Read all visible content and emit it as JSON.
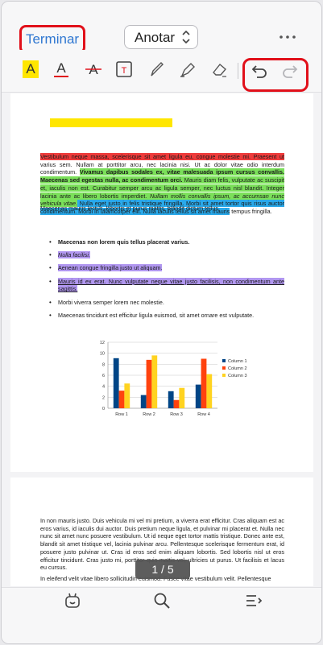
{
  "header": {
    "done_label": "Terminar",
    "mode_label": "Anotar",
    "more_icon": "more-horizontal-icon"
  },
  "toolbar": {
    "tools": [
      "highlight-icon",
      "underline-icon",
      "strikethrough-icon",
      "text-box-icon",
      "pen-icon",
      "marker-icon",
      "eraser-icon",
      "undo-icon",
      "redo-icon"
    ],
    "highlight_glyph": "A",
    "underline_glyph": "A",
    "strike_glyph": "A",
    "textbox_glyph": "T"
  },
  "page1": {
    "para1_parts": [
      "Vestibulum neque massa, scelerisque sit amet ligula eu, congue molestie mi. Praesent ut",
      " varius sem. Nullam at porttitor arcu, nec lacinia nisi. Ut ac dolor vitae odio interdum condimentum. ",
      "Vivamus dapibus sodales ex, vitae malesuada ipsum cursus convallis. Maecenas sed egestas nulla, ac condimentum orci.",
      " Mauris diam felis, vulputate ac suscipit et, iaculis non est. Curabitur semper arcu ac ligula semper, nec luctus nisl blandit. Integer lacinia ante ac libero lobortis imperdiet. ",
      "Nullam mollis convallis ipsum, ac accumsan nunc vehicula vitae.",
      " Nulla eget justo in felis tristique fringilla. Morbi sit amet tortor quis risus auctor condimentum. Morbi in ullamcorper elit. Nulla iaculis tellus sit amet mauris",
      " tempus fringilla."
    ],
    "para2": "Maecenas mauris lectus, lobortis et purus mattis, blandit dictum tellus.",
    "bullets": [
      "Maecenas non lorem quis tellus placerat varius.",
      "Nulla facilisi.",
      "Aenean congue fringilla justo ut aliquam.",
      "Mauris id ex erat. Nunc vulputate neque vitae justo facilisis, non condimentum ante sagittis.",
      "Morbi viverra semper lorem nec molestie.",
      "Maecenas tincidunt est efficitur ligula euismod, sit amet ornare est vulputate."
    ]
  },
  "chart_data": {
    "type": "bar",
    "categories": [
      "Row 1",
      "Row 2",
      "Row 3",
      "Row 4"
    ],
    "series": [
      {
        "name": "Column 1",
        "values": [
          9.1,
          2.4,
          3.1,
          4.3
        ],
        "color": "#004586"
      },
      {
        "name": "Column 2",
        "values": [
          3.2,
          8.8,
          1.5,
          9.0
        ],
        "color": "#ff420e"
      },
      {
        "name": "Column 3",
        "values": [
          4.5,
          9.6,
          3.7,
          6.2
        ],
        "color": "#ffd320"
      }
    ],
    "yticks": [
      "0",
      "2",
      "4",
      "6",
      "8",
      "10",
      "12"
    ],
    "ylim": [
      0,
      12
    ],
    "grid": true,
    "legend": "right"
  },
  "page2": {
    "para1": "In non mauris justo. Duis vehicula mi vel mi pretium, a viverra erat efficitur. Cras aliquam est ac eros varius, id iaculis dui auctor. Duis pretium neque ligula, et pulvinar mi placerat et. Nulla nec nunc sit amet nunc posuere vestibulum. Ut id neque eget tortor mattis tristique. Donec ante est, blandit sit amet tristique vel, lacinia pulvinar arcu. Pellentesque scelerisque fermentum erat, id posuere justo pulvinar ut. Cras id eros sed enim aliquam lobortis. Sed lobortis nisl ut eros efficitur tincidunt. Cras justo mi, porttitor quis mattis vel, ultricies ut purus. Ut facilisis et lacus eu cursus.",
    "para2": "In eleifend velit vitae libero sollicitudin euismod. Fusce vitae vestibulum velit. Pellentesque"
  },
  "page_indicator": "1 / 5",
  "bottom": {
    "icons": [
      "ai-assistant-icon",
      "search-icon",
      "outline-menu-icon"
    ]
  }
}
